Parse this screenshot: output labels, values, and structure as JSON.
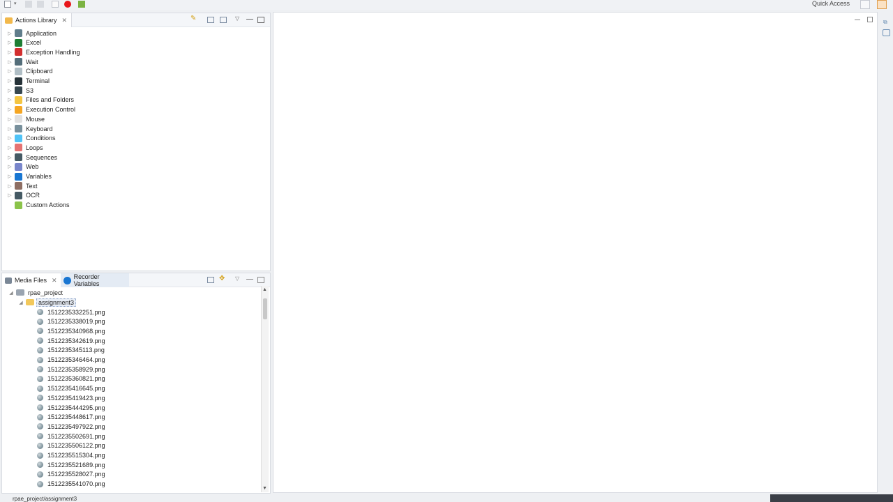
{
  "toolbar": {
    "quick_access": "Quick Access"
  },
  "actions_panel": {
    "tab_label": "Actions Library",
    "items": [
      {
        "label": "Application",
        "icon": "application-icon",
        "color": "#607d8b"
      },
      {
        "label": "Excel",
        "icon": "excel-icon",
        "color": "#1e7e34"
      },
      {
        "label": "Exception Handling",
        "icon": "flag-icon",
        "color": "#d32f2f"
      },
      {
        "label": "Wait",
        "icon": "clock-icon",
        "color": "#546e7a"
      },
      {
        "label": "Clipboard",
        "icon": "clipboard-icon",
        "color": "#b0bec5"
      },
      {
        "label": "Terminal",
        "icon": "terminal-icon",
        "color": "#263238"
      },
      {
        "label": "S3",
        "icon": "s3-icon",
        "color": "#37474f"
      },
      {
        "label": "Files and Folders",
        "icon": "folder-icon",
        "color": "#f4c542"
      },
      {
        "label": "Execution Control",
        "icon": "execution-control-icon",
        "color": "#f5a623"
      },
      {
        "label": "Mouse",
        "icon": "mouse-icon",
        "color": "#e0e0e0"
      },
      {
        "label": "Keyboard",
        "icon": "keyboard-icon",
        "color": "#78909c"
      },
      {
        "label": "Conditions",
        "icon": "conditions-icon",
        "color": "#4fc3f7"
      },
      {
        "label": "Loops",
        "icon": "loops-icon",
        "color": "#e57373"
      },
      {
        "label": "Sequences",
        "icon": "sequences-icon",
        "color": "#455a64"
      },
      {
        "label": "Web",
        "icon": "globe-icon",
        "color": "#7986cb"
      },
      {
        "label": "Variables",
        "icon": "variables-icon",
        "color": "#1976d2"
      },
      {
        "label": "Text",
        "icon": "text-icon",
        "color": "#8d6e63"
      },
      {
        "label": "OCR",
        "icon": "ocr-icon",
        "color": "#455a64"
      },
      {
        "label": "Custom Actions",
        "icon": "custom-actions-icon",
        "color": "#8bc34a"
      }
    ]
  },
  "media_panel": {
    "tab_label": "Media Files",
    "tab2_label": "Recorder Variables",
    "project": "rpae_project",
    "folder": "assignment3",
    "files": [
      "1512235332251.png",
      "1512235338019.png",
      "1512235340968.png",
      "1512235342619.png",
      "1512235345113.png",
      "1512235346464.png",
      "1512235358929.png",
      "1512235360821.png",
      "1512235416645.png",
      "1512235419423.png",
      "1512235444295.png",
      "1512235448617.png",
      "1512235497922.png",
      "1512235502691.png",
      "1512235506122.png",
      "1512235515304.png",
      "1512235521689.png",
      "1512235528027.png",
      "1512235541070.png"
    ]
  },
  "statusbar": {
    "path": "rpae_project/assignment3"
  },
  "colors": {
    "background": "#eef0f3",
    "panel": "#ffffff",
    "record": "#e8161b",
    "selection": "#e8eef7"
  }
}
